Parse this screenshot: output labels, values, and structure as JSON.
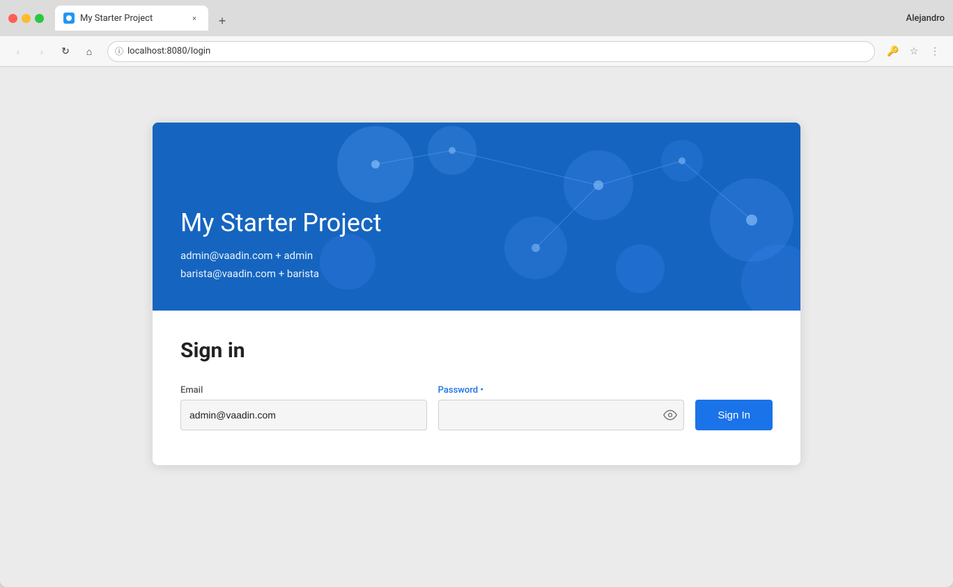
{
  "browser": {
    "tab_title": "My Starter Project",
    "tab_close_label": "×",
    "new_tab_label": "+",
    "user_name": "Alejandro",
    "url": "localhost:8080/login",
    "nav": {
      "back_label": "‹",
      "forward_label": "›",
      "reload_label": "↻",
      "home_label": "⌂",
      "key_icon": "🔑",
      "star_icon": "☆",
      "menu_icon": "⋮"
    }
  },
  "hero": {
    "title": "My Starter Project",
    "hint_line1": "admin@vaadin.com + admin",
    "hint_line2": "barista@vaadin.com + barista"
  },
  "form": {
    "sign_in_heading": "Sign in",
    "email_label": "Email",
    "email_value": "admin@vaadin.com",
    "email_placeholder": "Email",
    "password_label": "Password",
    "password_placeholder": "",
    "sign_in_button": "Sign In"
  }
}
